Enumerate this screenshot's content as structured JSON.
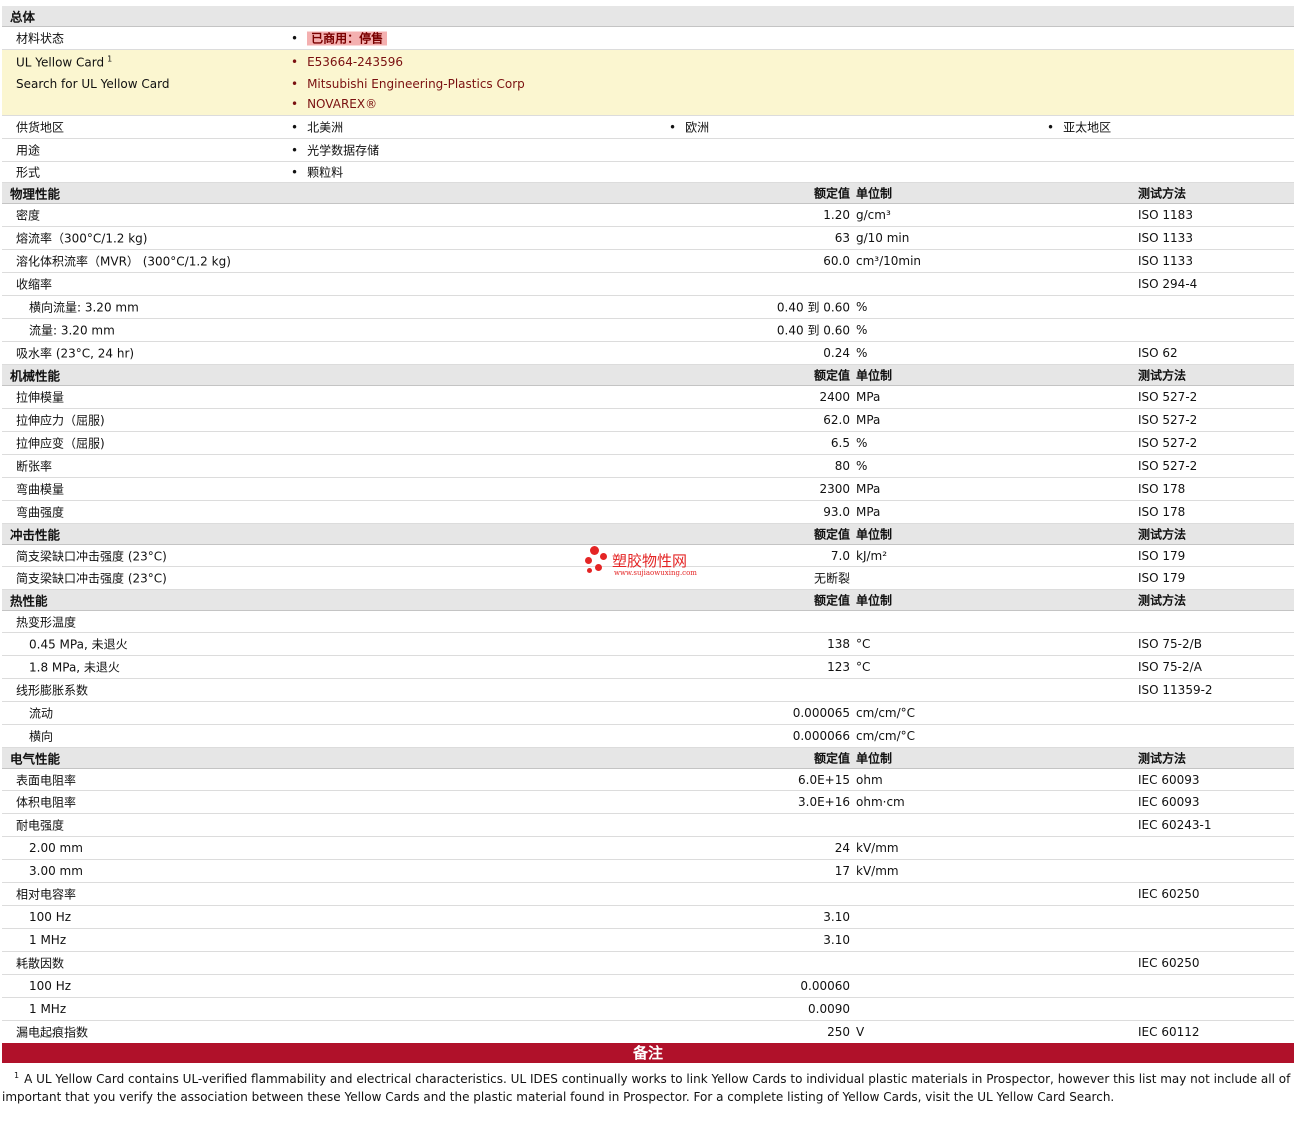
{
  "general": {
    "title": "总体",
    "material_status_label": "材料状态",
    "material_status_value": "已商用：停售",
    "ul_card_label": "UL Yellow Card",
    "ul_card_sup": "1",
    "ul_card_value": "E53664-243596",
    "search_label": "Search for UL Yellow Card",
    "search_links": [
      "Mitsubishi Engineering-Plastics Corp",
      "NOVAREX®"
    ],
    "supply_label": "供货地区",
    "supply_regions": [
      "北美洲",
      "欧洲",
      "亚太地区"
    ],
    "use_label": "用途",
    "use_value": "光学数据存储",
    "form_label": "形式",
    "form_value": "颗粒料"
  },
  "columns": {
    "nominal": "额定值",
    "unit": "单位制",
    "test": "测试方法"
  },
  "sections": {
    "physical": {
      "title": "物理性能",
      "rows": [
        {
          "label": "密度",
          "value": "1.20",
          "unit": "g/cm³",
          "test": "ISO 1183"
        },
        {
          "label": "熔流率（300°C/1.2 kg)",
          "value": "63",
          "unit": "g/10 min",
          "test": "ISO 1133"
        },
        {
          "label": "溶化体积流率（MVR） (300°C/1.2 kg)",
          "value": "60.0",
          "unit": "cm³/10min",
          "test": "ISO 1133"
        },
        {
          "label": "收缩率",
          "test": "ISO 294-4"
        },
        {
          "sub": "横向流量: 3.20 mm",
          "range": "0.40 到  0.60",
          "unit": "%"
        },
        {
          "sub": "流量: 3.20 mm",
          "range": "0.40 到  0.60",
          "unit": "%"
        },
        {
          "label": "吸水率 (23°C, 24 hr)",
          "value": "0.24",
          "unit": "%",
          "test": "ISO 62"
        }
      ]
    },
    "mechanical": {
      "title": "机械性能",
      "rows": [
        {
          "label": "拉伸模量",
          "value": "2400",
          "unit": "MPa",
          "test": "ISO 527-2"
        },
        {
          "label": "拉伸应力（屈服)",
          "value": "62.0",
          "unit": "MPa",
          "test": "ISO 527-2"
        },
        {
          "label": "拉伸应变（屈服)",
          "value": "6.5",
          "unit": "%",
          "test": "ISO 527-2"
        },
        {
          "label": "断张率",
          "value": "80",
          "unit": "%",
          "test": "ISO 527-2"
        },
        {
          "label": "弯曲模量",
          "value": "2300",
          "unit": "MPa",
          "test": "ISO 178"
        },
        {
          "label": "弯曲强度",
          "value": "93.0",
          "unit": "MPa",
          "test": "ISO 178"
        }
      ]
    },
    "impact": {
      "title": "冲击性能",
      "rows": [
        {
          "label": "简支梁缺口冲击强度 (23°C)",
          "value": "7.0",
          "unit": "kJ/m²",
          "test": "ISO 179"
        },
        {
          "label": "简支梁缺口冲击强度 (23°C)",
          "value": "无断裂",
          "test": "ISO 179"
        }
      ]
    },
    "thermal": {
      "title": "热性能",
      "rows": [
        {
          "label": "热变形温度"
        },
        {
          "sub": "0.45 MPa, 未退火",
          "value": "138",
          "unit": "°C",
          "test": "ISO 75-2/B"
        },
        {
          "sub": "1.8 MPa, 未退火",
          "value": "123",
          "unit": "°C",
          "test": "ISO 75-2/A"
        },
        {
          "label": "线形膨胀系数",
          "test": "ISO 11359-2"
        },
        {
          "sub": "流动",
          "value": "0.000065",
          "unit": "cm/cm/°C"
        },
        {
          "sub": "横向",
          "value": "0.000066",
          "unit": "cm/cm/°C"
        }
      ]
    },
    "electrical": {
      "title": "电气性能",
      "rows": [
        {
          "label": "表面电阻率",
          "value": "6.0E+15",
          "unit": "ohm",
          "test": "IEC 60093"
        },
        {
          "label": "体积电阻率",
          "value": "3.0E+16",
          "unit": "ohm·cm",
          "test": "IEC 60093"
        },
        {
          "label": "耐电强度",
          "test": "IEC 60243-1"
        },
        {
          "sub": "2.00 mm",
          "value": "24",
          "unit": "kV/mm"
        },
        {
          "sub": "3.00 mm",
          "value": "17",
          "unit": "kV/mm"
        },
        {
          "label": "相对电容率",
          "test": "IEC 60250"
        },
        {
          "sub": "100 Hz",
          "value": "3.10"
        },
        {
          "sub": "1 MHz",
          "value": "3.10"
        },
        {
          "label": "耗散因数",
          "test": "IEC 60250"
        },
        {
          "sub": "100 Hz",
          "value": "0.00060"
        },
        {
          "sub": "1 MHz",
          "value": "0.0090"
        },
        {
          "label": "漏电起痕指数",
          "value": "250",
          "unit": "V",
          "test": "IEC 60112"
        }
      ]
    }
  },
  "notes": {
    "title": "备注",
    "footnote_marker": "1",
    "line1": "A UL Yellow Card contains UL-verified flammability and electrical characteristics. UL IDES continually works to link Yellow Cards to individual plastic materials in Prospector, however this list may not include all of the appr",
    "line2": "important that you verify the association between these Yellow Cards and the plastic material found in Prospector. For a complete listing of Yellow Cards, visit the UL Yellow Card Search."
  },
  "watermark": {
    "title": "塑胶物性网",
    "url": "www.sujiaowuxing.com"
  }
}
